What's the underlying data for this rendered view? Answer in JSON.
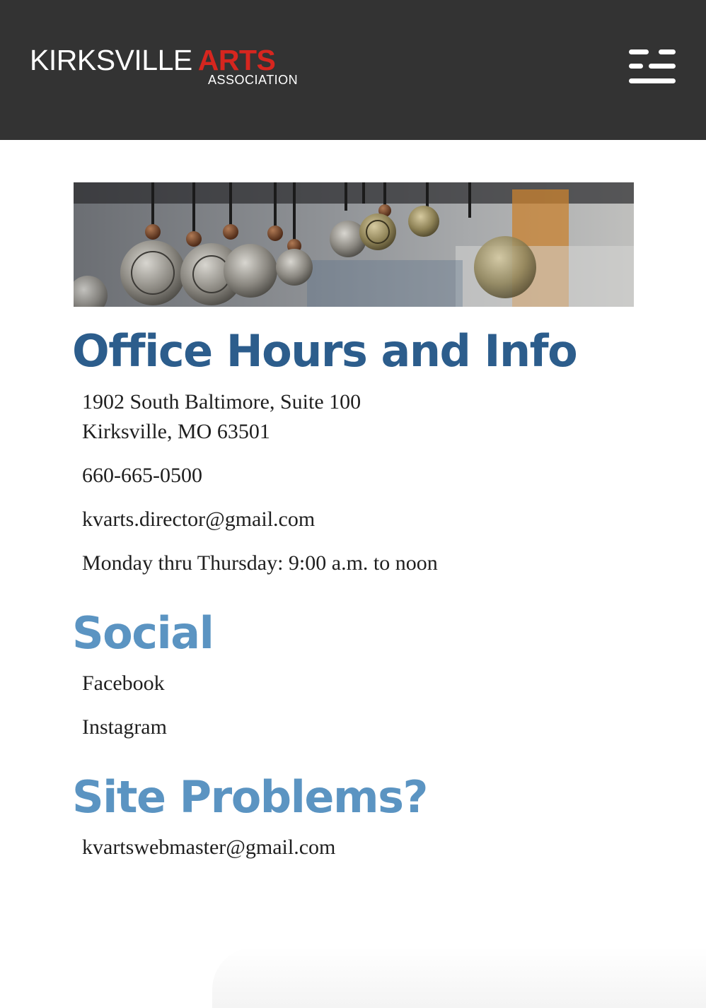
{
  "header": {
    "logo": {
      "word1": "KIRKSVILLE",
      "word2": "ARTS",
      "word3": "ASSOCIATION"
    },
    "menu_icon": "hamburger-menu-icon"
  },
  "banner": {
    "image": "hanging-compass-pendants-photo"
  },
  "office": {
    "heading": "Office Hours and Info",
    "address_line1": "1902 South Baltimore, Suite 100",
    "address_line2": "Kirksville, MO 63501",
    "phone": "660-665-0500",
    "email": "kvarts.director@gmail.com",
    "hours": "Monday thru Thursday: 9:00 a.m. to noon"
  },
  "social": {
    "heading": "Social",
    "links": [
      "Facebook",
      "Instagram"
    ]
  },
  "problems": {
    "heading": "Site Problems?",
    "email": "kvartswebmaster@gmail.com"
  },
  "colors": {
    "header_bg": "#333333",
    "logo_red": "#d6261f",
    "heading_dark_blue": "#2c5d8c",
    "heading_light_blue": "#5b94c2"
  }
}
